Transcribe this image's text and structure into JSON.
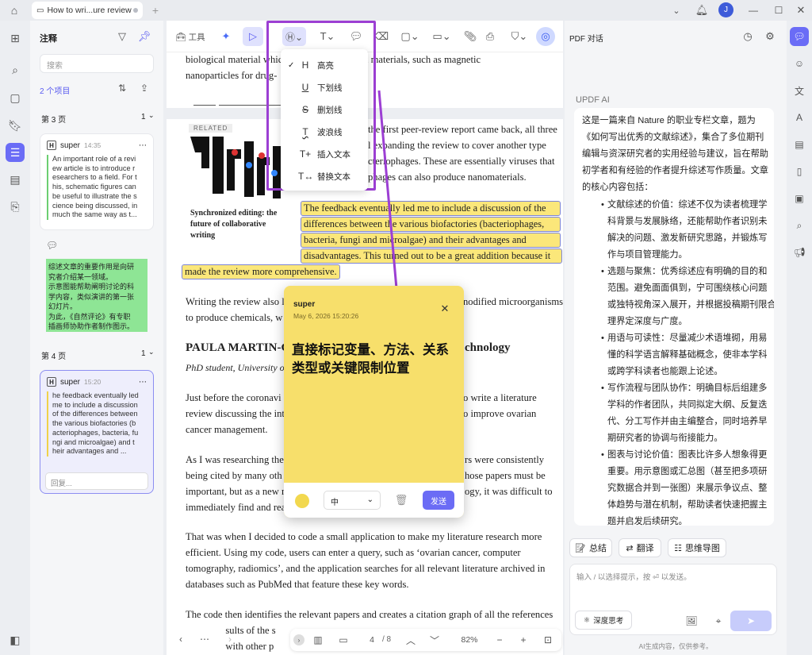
{
  "tab": {
    "title": "How to wri...ure review",
    "add": "+"
  },
  "window": {
    "avatar": "J"
  },
  "annotations": {
    "title": "注释",
    "search_placeholder": "搜索",
    "count": "2 个项目",
    "page3": "第 3 页",
    "page3_count": "1",
    "page4": "第 4 页",
    "page4_count": "1",
    "card1": {
      "user": "super",
      "time": "14:35",
      "quote": "An important role of a revi\new article is to introduce r\nesearchers to a field. For t\nhis, schematic figures can\nbe useful to illustrate the s\ncience being discussed, in\nmuch the same way as t...",
      "note": "综述文章的重要作用是向研\n究者介绍某一领域。\n示意图能帮助阐明讨论的科\n学内容，类似演讲的第一张\n幻灯片。\n为此，《自然评论》有专职\n插画师协助作者制作图示。"
    },
    "card2": {
      "user": "super",
      "time": "15:20",
      "quote": "he feedback eventually led\nme to include a discussion\nof the differences between\nthe various biofactories (b\nacteriophages, bacteria, fu\nngi and microalgae) and t\nheir advantages and ...",
      "reply_placeholder": "回复..."
    }
  },
  "toolbar": {
    "tools_label": "工具"
  },
  "dropdown": {
    "items": [
      "高亮",
      "下划线",
      "删划线",
      "波浪线",
      "插入文本",
      "替换文本"
    ],
    "icons": [
      "H",
      "U",
      "S",
      "T",
      "T+",
      "T↔"
    ]
  },
  "doc": {
    "top_lines": [
      "biological material whic              oduce useful materials, such as magnetic",
      "nanoparticles for drug-"
    ],
    "related": "RELATED",
    "caption": [
      "Synchronized editing: the",
      "future of collaborative",
      "writing"
    ],
    "right_lines": [
      "the first peer-review report came back, all three",
      "l expanding the review to cover another type",
      "cteriophages. These are essentially viruses that",
      "phages can also produce nanomaterials."
    ],
    "hl_lines": [
      "The feedback eventually led me to include a discussion of the",
      "differences between the various biofactories (bacteriophages,",
      "bacteria, fungi and microalgae) and their advantages and",
      "disadvantages. This turned out to be a great addition because it"
    ],
    "hl_last": "made the review more comprehensive.",
    "p2": [
      "Writing the review also l",
      "to produce chemicals, w"
    ],
    "p2r": [
      "nodified microorganisms",
      ""
    ],
    "heading_left": "PAULA MARTIN-G",
    "heading_right": "chnology",
    "role": "PhD student, University o",
    "p3l": [
      "Just before the coronavi",
      "review discussing the int",
      "cancer management."
    ],
    "p3r": [
      "o write a literature",
      "o improve ovarian",
      ""
    ],
    "p4l": [
      "As I was researching the",
      "being cited by many oth",
      "important, but as a new r",
      "immediately find and rea"
    ],
    "p4r": [
      "rs were consistently",
      "hose papers must be",
      "ogy, it was difficult to",
      ""
    ],
    "p5": [
      "That was when I decided to code a small application to make my literature research more",
      "efficient. Using my code, users can enter a query, such as ‘ovarian cancer, computer",
      "tomography, radiomics’, and the application searches for all relevant literature archived in",
      "databases such as PubMed that feature these key words."
    ],
    "p6": [
      "The code then identifies the relevant papers and creates a citation graph of all the references",
      "                sults of the s",
      "                with other p"
    ]
  },
  "note": {
    "user": "super",
    "date": "May 6, 2026 15:20:26",
    "text": "直接标记变量、方法、关系类型或关键限制位置",
    "font_size": "中",
    "send": "发送",
    "color": "#f7df6b"
  },
  "docbar": {
    "page": "4",
    "total": "/ 8",
    "zoom": "82%"
  },
  "right": {
    "title": "PDF 对话",
    "ai_title": "UPDF AI",
    "intro": [
      "这是一篇来自 Nature 的职业专栏文章，题为",
      "《如何写出优秀的文献综述》，集合了多位期刊",
      "编辑与资深研究者的实用经验与建议，旨在帮助",
      "初学者和有经验的作者提升综述写作质量。文章",
      "的核心内容包括："
    ],
    "bullets": [
      [
        "文献综述的价值：综述不仅为读者梳理学",
        "科背景与发展脉络，还能帮助作者识别未",
        "解决的问题、激发新研究思路，并锻炼写",
        "作与项目管理能力。"
      ],
      [
        "选题与聚焦：优秀综述应有明确的目的和",
        "范围。避免面面俱到，宁可围绕核心问题",
        "或独特视角深入展开，并根据投稿期刊限合",
        "理界定深度与广度。"
      ],
      [
        "用语与可读性：尽量减少术语堆砌，用易",
        "懂的科学语言解释基础概念，使非本学科",
        "或跨学科读者也能跟上论述。"
      ],
      [
        "写作流程与团队协作：明确目标后组建多",
        "学科的作者团队，共同拟定大纲、反复迭",
        "代、分工写作并由主编整合，同时培养早",
        "期研究者的协调与衔接能力。"
      ],
      [
        "图表与讨论价值：图表比许多人想象得更",
        "重要。用示意图或汇总图（甚至把多项研",
        "究数据合并到一张图）来展示争议点、整",
        "体趋势与潜在机制，帮助读者快速把握主",
        "题并启发后续研究。"
      ]
    ],
    "actions": [
      "总结",
      "翻译",
      "思维导图"
    ],
    "input_placeholder": "输入 / 以选择提示，按 ⏎ 以发送。",
    "deep": "深度思考",
    "disclaimer": "AI生成内容，仅供参考。"
  }
}
